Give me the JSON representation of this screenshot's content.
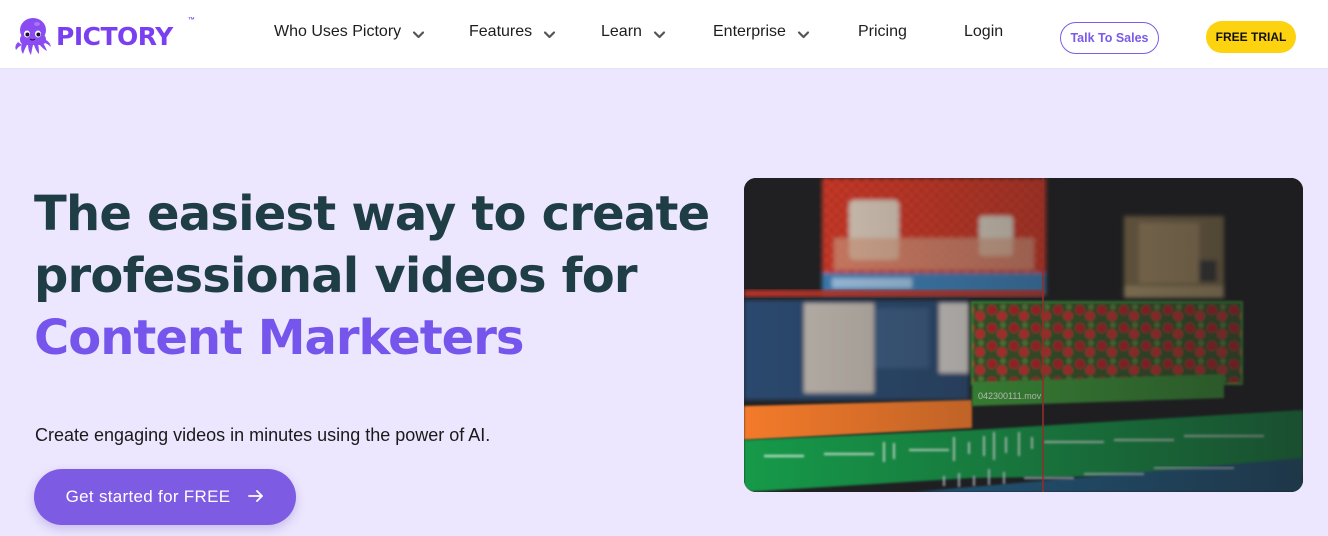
{
  "brand": {
    "name": "PICTORY",
    "trademark": "™",
    "color": "#7a3ff0"
  },
  "nav": {
    "items": [
      {
        "label": "Who Uses Pictory",
        "has_dropdown": true
      },
      {
        "label": "Features",
        "has_dropdown": true
      },
      {
        "label": "Learn",
        "has_dropdown": true
      },
      {
        "label": "Enterprise",
        "has_dropdown": true
      },
      {
        "label": "Pricing",
        "has_dropdown": false
      },
      {
        "label": "Login",
        "has_dropdown": false
      }
    ],
    "talk_to_sales": "Talk To Sales",
    "free_trial": "FREE TRIAL"
  },
  "hero": {
    "title_line1": "The easiest way to create",
    "title_line2": "professional videos for",
    "title_accent": "Content Marketers",
    "subtitle": "Create engaging videos in minutes using the power of AI.",
    "cta_label": "Get started for FREE",
    "cta_icon": "arrow-right-icon",
    "media_clip_label": "042300111.mov"
  },
  "colors": {
    "page_bg": "#ece7fe",
    "title": "#1f3d45",
    "accent": "#7655ec",
    "cta_bg": "#7e5be3",
    "trial_bg": "#fdd20e",
    "sales_border": "#7c5ce8"
  }
}
